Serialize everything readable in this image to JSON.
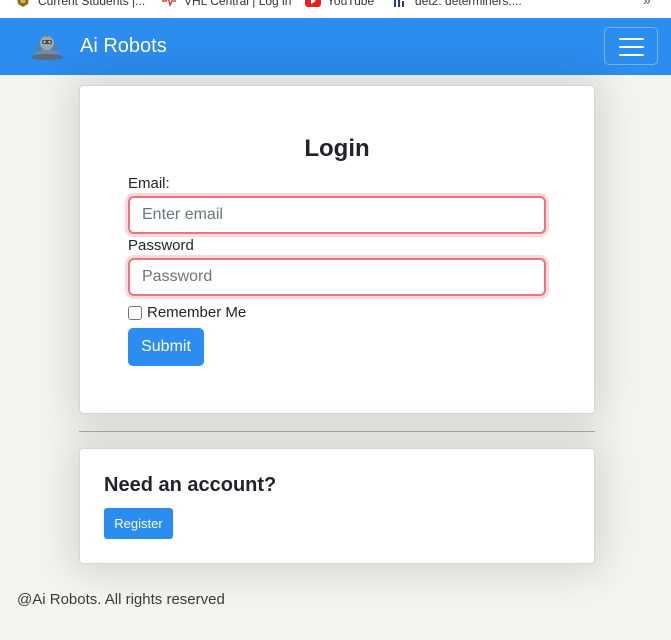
{
  "bookmarks": [
    {
      "label": "Current Students |...",
      "icon": "university-crest-icon"
    },
    {
      "label": "VHL Central | Log in",
      "icon": "vhl-heartbeat-icon"
    },
    {
      "label": "YouTube",
      "icon": "youtube-icon"
    },
    {
      "label": "det2: determiners....",
      "icon": "bars-chart-icon"
    }
  ],
  "bookmarks_more": "»",
  "navbar": {
    "brand": "Ai Robots",
    "logo_icon": "robot-logo-icon",
    "menu_icon": "hamburger-icon"
  },
  "login": {
    "title": "Login",
    "email_label": "Email:",
    "email_placeholder": "Enter email",
    "email_value": "",
    "password_label": "Password",
    "password_placeholder": "Password",
    "password_value": "",
    "remember_label": "Remember Me",
    "remember_checked": false,
    "submit_label": "Submit"
  },
  "register": {
    "title": "Need an account?",
    "button_label": "Register"
  },
  "footer": "@Ai Robots. All rights reserved",
  "colors": {
    "primary": "#2b8def",
    "invalid_border": "#e8777d",
    "page_bg": "#f5f4ef"
  }
}
